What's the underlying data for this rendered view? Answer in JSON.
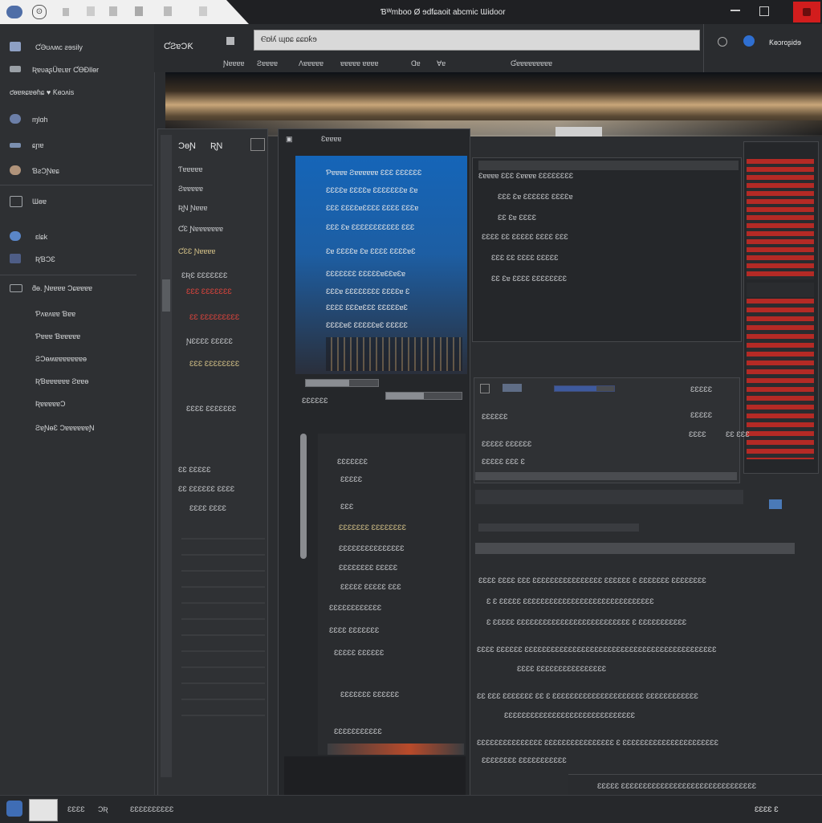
{
  "window": {
    "title": "Ɓᵂmboo Ø ɘdfɕaoit abcmic Ɯidoor",
    "account_label": "Ƙɵɔroʂidɘ"
  },
  "tabs": [
    "ƨɐ",
    "ⓢ"
  ],
  "sidebar": {
    "items": [
      {
        "label": "ƇƏʊʌʍc ƨɘsily",
        "icon": "drive-icon"
      },
      {
        "label": "ƦɐʋaʂÜɐʟɐr ƇƟƉllɵr",
        "icon": "keyboard-icon"
      },
      {
        "label": "ƈɵɐʀɕɐɵɦɕ ♥ Ƙɵɔʌis",
        "icon": "heart-icon"
      },
      {
        "label": "ɱlɑh",
        "icon": "globe-icon"
      },
      {
        "label": "ɕɲɐ",
        "icon": "satellite-icon"
      },
      {
        "label": "ƁƨƆƝɐɕ",
        "icon": "user-icon"
      },
      {
        "label": "Ɯɵɐ",
        "icon": "monitor-icon"
      },
      {
        "label": "ɛlɕk",
        "icon": "earth-icon"
      },
      {
        "label": "ƦƁƆƐ",
        "icon": "chip-icon"
      },
      {
        "label": "ƌɵ. Ɲɐɐɐɐ Ɔɕɐɐɐɐ",
        "icon": "folder-icon"
      },
      {
        "label": "Ƥʌɐʌɐɐ Ɓɐɐ",
        "icon": ""
      },
      {
        "label": "Ƥɐɐɐ Ɓɐɐɐɐɐ",
        "icon": ""
      },
      {
        "label": "ƧƆɵʍɐɐɐɐɐɐɐɵ",
        "icon": ""
      },
      {
        "label": "ƦƁɐɐɐɐɐɐ Ƨɐɐɵ",
        "icon": ""
      },
      {
        "label": "ƦɐɐɐɐɐƆ",
        "icon": ""
      },
      {
        "label": "ƧɐƝɵƐ ƆɐɐɐɐɐɐƝ",
        "icon": ""
      }
    ]
  },
  "toolbar": {
    "app_name": "ƇƧɐƆƘ",
    "url_value": "Ⲉɒƚʎ ɰɒɕ ɕɕɒƙɘ",
    "menu": [
      "Ɲɐɐɐɐ",
      "Ƨɐɐɐɐ",
      "Ʌɐɐɐɐɐ",
      "ɐɐɐɐɐ ɐɐɐɐ",
      "Ɑɐ",
      "Ɐɐ"
    ],
    "center_label": "Ɠɐɐɐɐɐɐɐɐɐ"
  },
  "left_panel": {
    "header": [
      "ƆɵƝ",
      "ƦƝ"
    ],
    "rows": [
      "Ƭɐɐɐɐɐ",
      "Ƨɐɐɐɐɐ",
      "ƦƝ Ɲɐɐɐ",
      "ƇƐ Ɲɐɐɐɐɐɐɐ",
      "ƇƐƐ Ɲɐɐɐɐ",
      "ƐƦƐ ƐƐƐƐƐƐƐ",
      "ƝƐƐƐƐ ƐƐƐƐƐ",
      "ƐƐƐ ƐƐƐƐƐƐƐƐ",
      "ƐƐƐƐ ƐƐƐƐƐƐƐ",
      "ƐƐ ƐƐƐƐƐ",
      "ƐƐ ƐƐƐƐƐƐ ƐƐƐƐ",
      "ƐƐƐƐ ƐƐƐƐ"
    ],
    "highlight_rows": [
      "ƐƐƐ ƐƐƐƐƐƐƐ",
      "ƐƐ ƐƐƐƐƐƐƐƐƐ"
    ]
  },
  "blue_panel": {
    "rows": [
      "Ƥɐɐɐɐ Ƨɐɐɐɐɐɐ ƐƐƐ ƐƐƐƐƐƐ",
      "ƐƐƐƐɐ ƐƐƐƐɐ ƐƐƐƐƐƐƐɐ Ɛɐ",
      "ƐƐƐ ƐƐƐƐɐƐƐƐƐ ƐƐƐƐ ƐƐƐɐ",
      "ƐƐƐ Ɛɐ ƐƐƐƐƐƐƐƐƐƐƐ ƐƐƐ",
      "Ɛɐ ƐƐƐƐɐ Ɛɐ ƐƐƐƐ ƐƐƐƐɐƐ",
      "ƐƐƐƐƐƐƐ ƐƐƐƐƐɐƐƐɐƐɐ",
      "ƐƐƐɐ ƐƐƐƐƐƐƐƐ ƐƐƐƐɐ Ɛ",
      "ƐƐƐƐ ƐƐƐɐƐƐƐ ƐƐƐƐƐɐƐ",
      "ƐƐƐƐɐƐ ƐƐƐƐƐɐƐ ƐƐƐƐƐ"
    ],
    "sub_label": "Ɛɐɐɐɐ",
    "sub_value": "ƐƐƐƐƐƐ"
  },
  "center_panel": {
    "header": "ƐƐƐƐƐƐ",
    "rows": [
      "ƐƐƐƐƐƐƐ",
      "ƐƐƐƐƐ",
      "ƐƐƐ",
      "ƐƐƐƐƐƐƐ ƐƐƐƐƐƐƐƐ",
      "ƐƐƐƐƐƐƐƐƐƐƐƐƐƐƐ",
      "ƐƐƐƐƐƐƐƐ ƐƐƐƐƐ",
      "ƐƐƐƐƐ ƐƐƐƐƐ ƐƐƐ",
      "ƐƐƐƐƐƐƐƐƐƐƐƐ",
      "ƐƐƐƐ ƐƐƐƐƐƐƐ",
      "ƐƐƐƐƐ ƐƐƐƐƐƐ",
      "ƐƐƐƐƐƐƐ ƐƐƐƐƐƐ",
      "ƐƐƐƐƐƐƐƐƐƐƐ"
    ]
  },
  "right_top_panel": {
    "rows": [
      "Ɛɐɐɐɐ ƐƐƐ Ɛɐɐɐɐ ƐƐƐƐƐƐƐƐ",
      "ƐƐƐ Ɛɐ ƐƐƐƐƐƐ ƐƐƐƐɐ",
      "ƐƐ Ɛɐ ƐƐƐƐ",
      "ƐƐƐƐ ƐƐ ƐƐƐƐƐ ƐƐƐƐ ƐƐƐ",
      "ƐƐƐ ƐƐ ƐƐƐƐ ƐƐƐƐƐ",
      "ƐƐ Ɛɐ ƐƐƐƐ ƐƐƐƐƐƐƐƐ"
    ]
  },
  "right_mid_panel": {
    "left_col": [
      "ƐƐƐƐƐƐ",
      "ƐƐƐƐƐ ƐƐƐƐƐƐ",
      "ƐƐƐƐƐ ƐƐƐ Ɛ"
    ],
    "right_col": [
      "ƐƐƐƐƐ",
      "ƐƐƐƐ",
      "ƐƐ ƐƐƐ"
    ],
    "header_value": "ƐƐƐƐƐ"
  },
  "right_bottom_panel": {
    "lines": [
      "ƐƐƐƐ ƐƐƐƐ ƐƐƐ ƐƐƐƐƐƐƐƐƐƐƐƐƐƐƐƐ ƐƐƐƐƐƐ Ɛ ƐƐƐƐƐƐƐ ƐƐƐƐƐƐƐƐ",
      "Ɛ Ɛ ƐƐƐƐƐ ƐƐƐƐƐƐƐƐƐƐƐƐƐƐƐƐƐƐƐƐƐƐƐƐƐƐƐƐƐƐ",
      "Ɛ ƐƐƐƐƐ ƐƐƐƐƐƐƐƐƐƐƐƐƐƐƐƐƐƐƐƐƐƐƐƐƐƐ Ɛ ƐƐƐƐƐƐƐƐƐƐƐ",
      "ƐƐƐƐ ƐƐƐƐƐƐ ƐƐƐƐƐƐƐƐƐƐƐƐƐƐƐƐƐƐƐƐƐƐƐƐƐƐƐƐƐƐƐƐƐƐƐƐƐƐƐƐƐƐƐƐ",
      "ƐƐƐƐ ƐƐƐƐƐƐƐƐƐƐƐƐƐƐƐƐ",
      "ƐƐ ƐƐƐ ƐƐƐƐƐƐƐ ƐƐ Ɛ ƐƐƐƐƐƐƐƐƐƐƐƐƐƐƐƐƐƐƐƐƐ ƐƐƐƐƐƐƐƐƐƐƐƐ",
      "ƐƐƐƐƐƐƐƐƐƐƐƐƐƐƐƐƐƐƐƐƐƐƐƐƐƐƐƐƐƐ",
      "ƐƐƐƐƐƐƐƐƐƐƐƐƐƐƐ ƐƐƐƐƐƐƐƐƐƐƐƐƐƐƐƐ Ɛ ƐƐƐƐƐƐƐƐƐƐƐƐƐƐƐƐƐƐƐƐƐƐ"
    ],
    "footer": "ƐƐƐƐƐƐƐƐ  ƐƐƐƐƐƐƐƐƐƐƐ"
  },
  "taskbar": {
    "items": [
      "ƐƐƐƐ",
      "ƆƦ",
      "ƐƐƐƐƐƐƐƐƐƐ"
    ],
    "right_label": "ƐƐƐƐ Ɛ",
    "bottom_right_text": "ƐƐƐƐƐ ƐƐƐƐƐƐƐƐƐƐƐƐƐƐƐƐƐƐƐƐƐƐƐƐƐƐƐƐƐƐƐ"
  },
  "colors": {
    "accent_red": "#d21d1d",
    "panel_blue": "#1565b8",
    "text_yellow": "#d8c58a"
  }
}
